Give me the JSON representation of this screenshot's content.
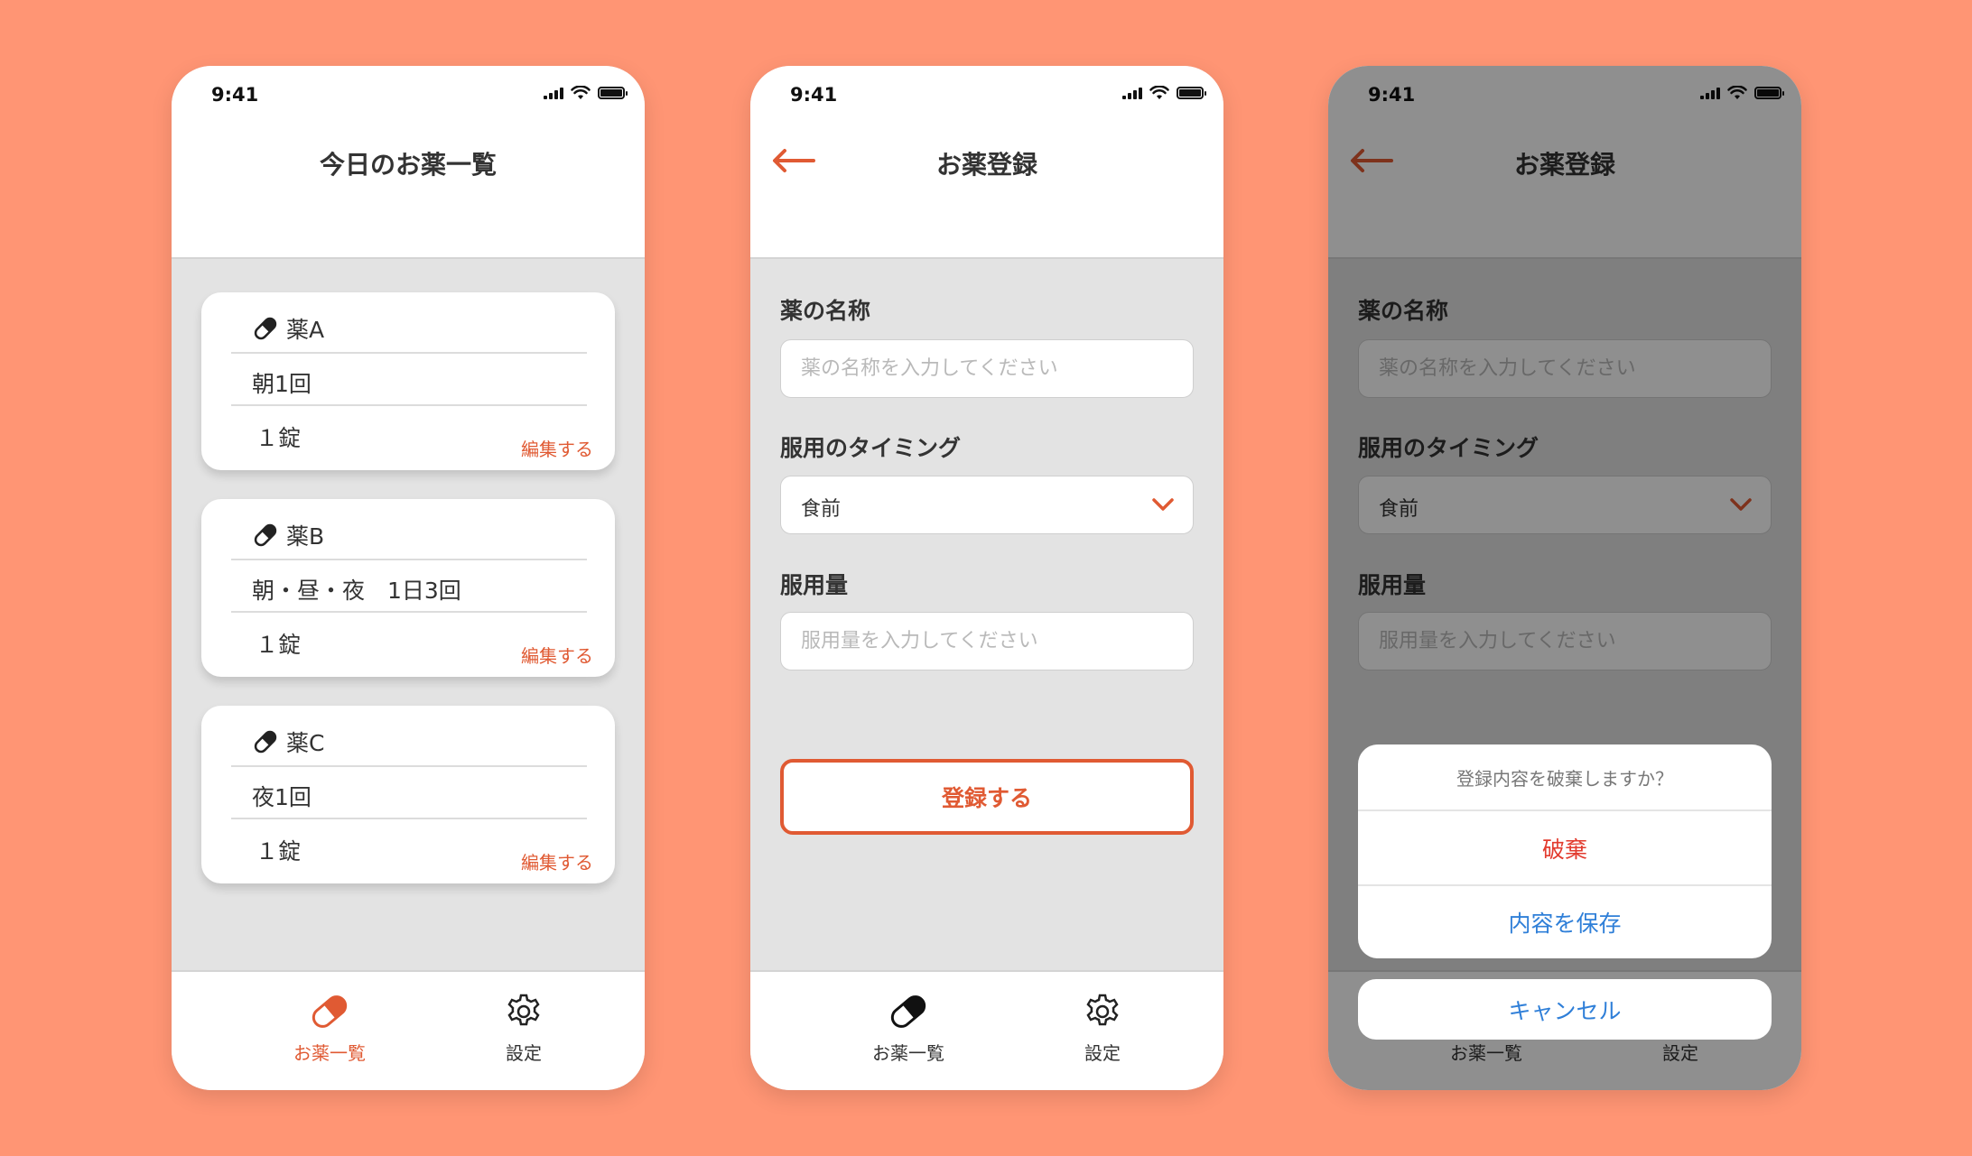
{
  "colors": {
    "background": "#FF9574",
    "accent": "#E05A33",
    "destructive": "#E23B2E",
    "link": "#2F7FD8"
  },
  "status": {
    "time": "9:41"
  },
  "screen_list": {
    "title": "今日のお薬一覧",
    "cards": [
      {
        "name": "薬A",
        "timing": "朝1回",
        "dose": "１錠",
        "edit_label": "編集する"
      },
      {
        "name": "薬B",
        "timing": "朝・昼・夜　1日3回",
        "dose": "１錠",
        "edit_label": "編集する"
      },
      {
        "name": "薬C",
        "timing": "夜1回",
        "dose": "１錠",
        "edit_label": "編集する"
      }
    ]
  },
  "screen_register": {
    "title": "お薬登録",
    "name_label": "薬の名称",
    "name_placeholder": "薬の名称を入力してください",
    "timing_label": "服用のタイミング",
    "timing_value": "食前",
    "dose_label": "服用量",
    "dose_placeholder": "服用量を入力してください",
    "submit_label": "登録する"
  },
  "tabbar": {
    "list_label": "お薬一覧",
    "settings_label": "設定"
  },
  "dialog": {
    "title": "登録内容を破棄しますか？",
    "discard_label": "破棄",
    "save_label": "内容を保存",
    "cancel_label": "キャンセル"
  }
}
